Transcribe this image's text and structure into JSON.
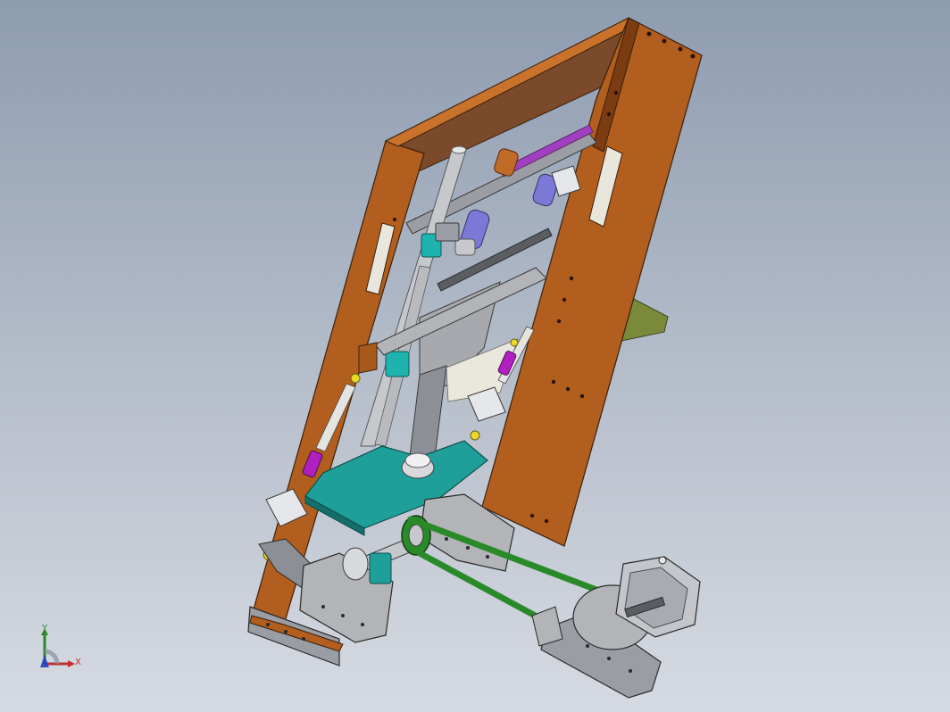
{
  "viewport": {
    "background_top": "#8e9cb0",
    "background_bottom": "#d6dae2"
  },
  "model": {
    "colors": {
      "frame_wood": "#b25e1e",
      "frame_wood_dark": "#7a3c10",
      "frame_wood_light": "#c9722c",
      "metal_gray": "#8c8f96",
      "metal_light": "#c6c8cc",
      "teal_plate": "#1f9f9a",
      "teal_dark": "#146e6a",
      "magenta_link": "#b020c0",
      "yellow_joint": "#e8d82a",
      "belt_green": "#2a8a2a",
      "motor_gray": "#9a9da6",
      "roller_purple": "#7c78d6",
      "copper": "#c06a2a",
      "green_pcb": "#7a8a3a"
    }
  },
  "triad": {
    "y_label": "Y",
    "x_label": "X",
    "x_color": "#c03030",
    "y_color": "#2a8a2a",
    "z_color": "#2040c0"
  }
}
